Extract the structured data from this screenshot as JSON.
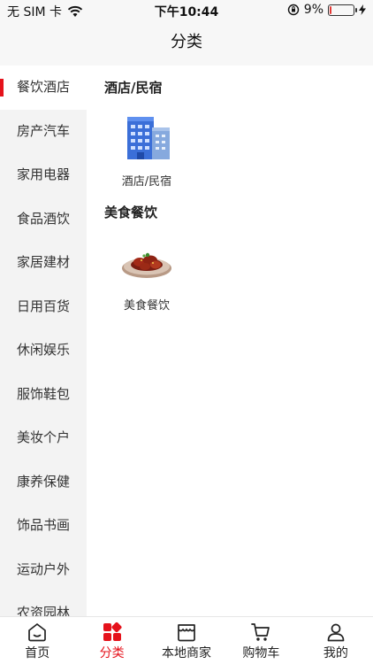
{
  "status_bar": {
    "carrier": "无 SIM 卡",
    "time": "下午10:44",
    "battery_percent": "9%",
    "battery_level": 0.09
  },
  "header": {
    "title": "分类"
  },
  "sidebar": {
    "items": [
      {
        "label": "餐饮酒店",
        "active": true
      },
      {
        "label": "房产汽车"
      },
      {
        "label": "家用电器"
      },
      {
        "label": "食品酒饮"
      },
      {
        "label": "家居建材"
      },
      {
        "label": "日用百货"
      },
      {
        "label": "休闲娱乐"
      },
      {
        "label": "服饰鞋包"
      },
      {
        "label": "美妆个户"
      },
      {
        "label": "康养保健"
      },
      {
        "label": "饰品书画"
      },
      {
        "label": "运动户外"
      },
      {
        "label": "农资园林"
      }
    ]
  },
  "content": {
    "sections": [
      {
        "title": "酒店/民宿",
        "items": [
          {
            "label": "酒店/民宿",
            "icon": "hotel-building-icon"
          }
        ]
      },
      {
        "title": "美食餐饮",
        "items": [
          {
            "label": "美食餐饮",
            "icon": "food-dish-icon"
          }
        ]
      }
    ]
  },
  "tabbar": {
    "tabs": [
      {
        "label": "首页",
        "icon": "home-icon"
      },
      {
        "label": "分类",
        "icon": "category-grid-icon",
        "active": true
      },
      {
        "label": "本地商家",
        "icon": "store-icon"
      },
      {
        "label": "购物车",
        "icon": "cart-icon"
      },
      {
        "label": "我的",
        "icon": "user-icon"
      }
    ]
  },
  "colors": {
    "accent": "#e5121b",
    "sidebar_bg": "#f3f3f3",
    "status_bg": "#f7f7f7"
  }
}
